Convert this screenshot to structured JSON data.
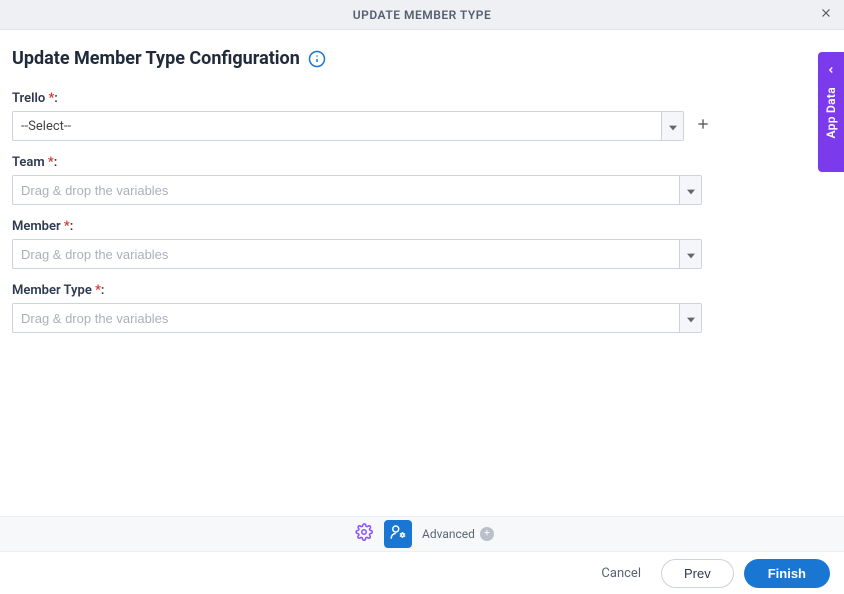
{
  "header": {
    "title": "UPDATE MEMBER TYPE"
  },
  "sideTab": {
    "label": "App Data"
  },
  "page": {
    "title": "Update Member Type Configuration"
  },
  "fields": {
    "trello": {
      "label": "Trello",
      "required": "*",
      "value": "--Select--"
    },
    "team": {
      "label": "Team",
      "required": "*",
      "placeholder": "Drag & drop the variables"
    },
    "member": {
      "label": "Member",
      "required": "*",
      "placeholder": "Drag & drop the variables"
    },
    "memberType": {
      "label": "Member Type",
      "required": "*",
      "placeholder": "Drag & drop the variables"
    }
  },
  "toolbar": {
    "advanced": "Advanced"
  },
  "footer": {
    "cancel": "Cancel",
    "prev": "Prev",
    "finish": "Finish"
  }
}
